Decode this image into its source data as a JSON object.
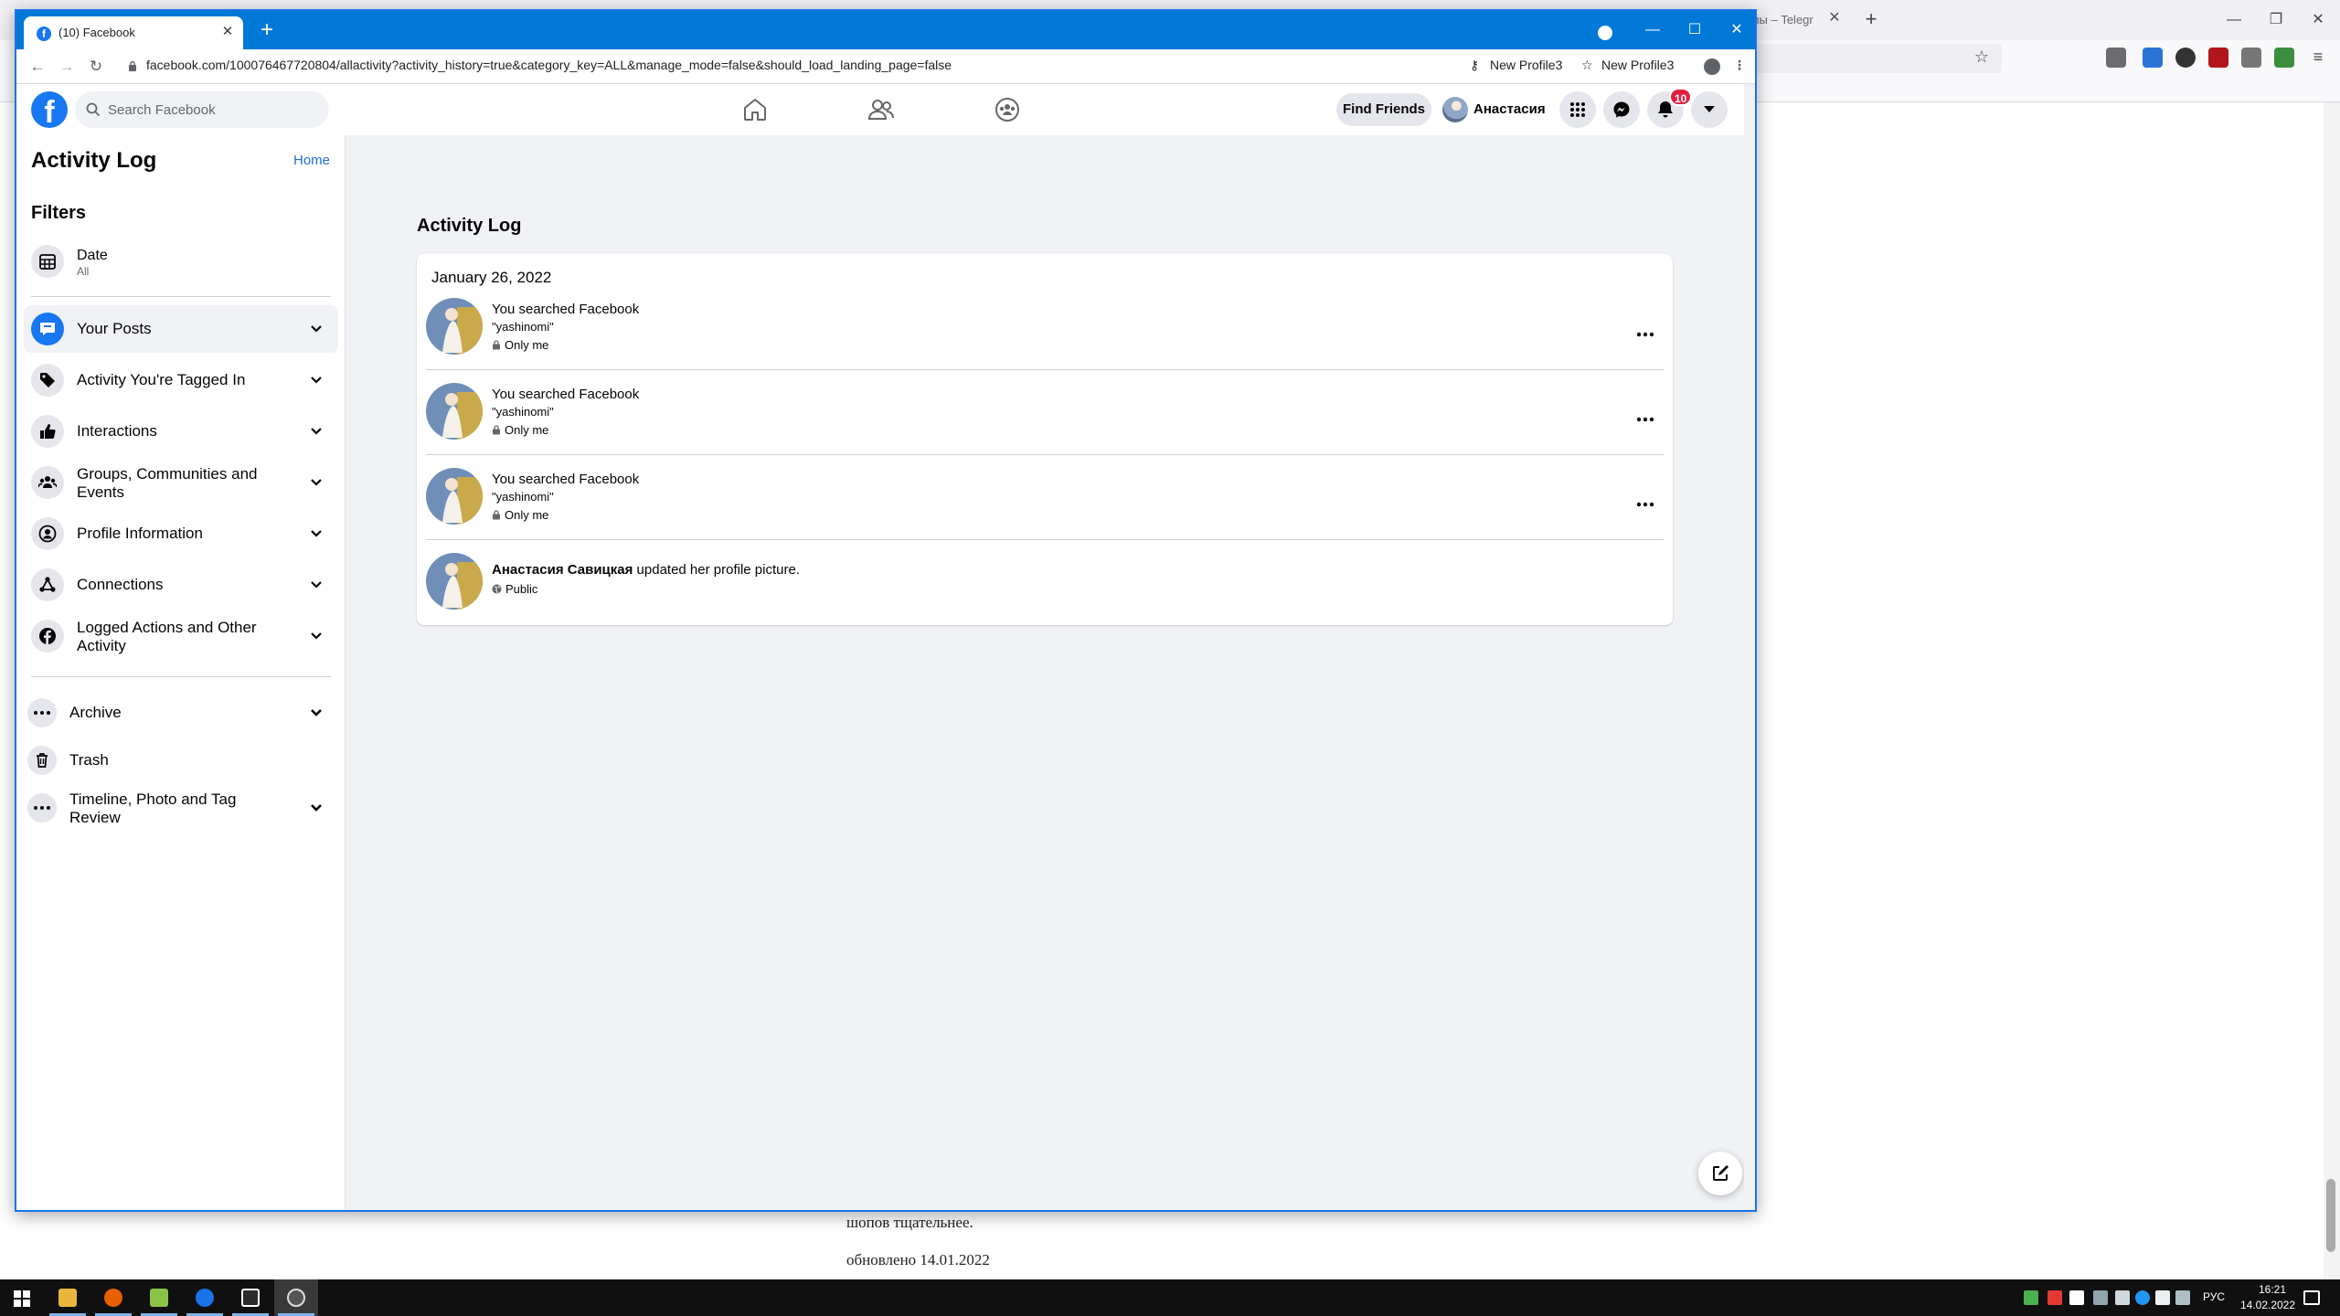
{
  "background_browser": {
    "tab_title": "олы – Telegr",
    "document_lines": [
      "шопов тщательнее.",
      "обновлено 14.01.2022"
    ]
  },
  "browser": {
    "tab_title": "(10) Facebook",
    "url": "facebook.com/100076467720804/allactivity?activity_history=true&category_key=ALL&manage_mode=false&should_load_landing_page=false",
    "bookmarks": [
      "New Profile3",
      "New Profile3"
    ]
  },
  "header": {
    "search_placeholder": "Search Facebook",
    "find_friends": "Find Friends",
    "profile_name": "Анастасия",
    "notification_count": "10"
  },
  "sidebar": {
    "title": "Activity Log",
    "home_link": "Home",
    "filters_heading": "Filters",
    "date_filter": {
      "label": "Date",
      "value": "All"
    },
    "categories": [
      {
        "label": "Your Posts",
        "icon": "posts-icon"
      },
      {
        "label": "Activity You're Tagged In",
        "icon": "tag-icon"
      },
      {
        "label": "Interactions",
        "icon": "like-icon"
      },
      {
        "label": "Groups, Communities and Events",
        "icon": "groups-icon"
      },
      {
        "label": "Profile Information",
        "icon": "profile-icon"
      },
      {
        "label": "Connections",
        "icon": "connections-icon"
      },
      {
        "label": "Logged Actions and Other Activity",
        "icon": "facebook-icon"
      }
    ],
    "extras": [
      {
        "label": "Archive",
        "icon": "more-icon"
      },
      {
        "label": "Trash",
        "icon": "trash-icon"
      },
      {
        "label": "Timeline, Photo and Tag Review",
        "icon": "more-icon"
      }
    ]
  },
  "main": {
    "title": "Activity Log",
    "date_heading": "January 26, 2022",
    "entries": [
      {
        "action": "You searched Facebook",
        "detail": "\"yashinomi\"",
        "privacy": "Only me"
      },
      {
        "action": "You searched Facebook",
        "detail": "\"yashinomi\"",
        "privacy": "Only me"
      },
      {
        "action": "You searched Facebook",
        "detail": "\"yashinomi\"",
        "privacy": "Only me"
      }
    ],
    "profile_update": {
      "name": "Анастасия Савицкая",
      "action": "updated her profile picture.",
      "privacy": "Public"
    }
  },
  "taskbar": {
    "language": "РУС",
    "time": "16:21",
    "date": "14.02.2022"
  },
  "colors": {
    "facebook_blue": "#1877f2",
    "chrome_titlebar": "#0078d7",
    "link_blue": "#216fdb",
    "notification_red": "#e41e3f"
  }
}
